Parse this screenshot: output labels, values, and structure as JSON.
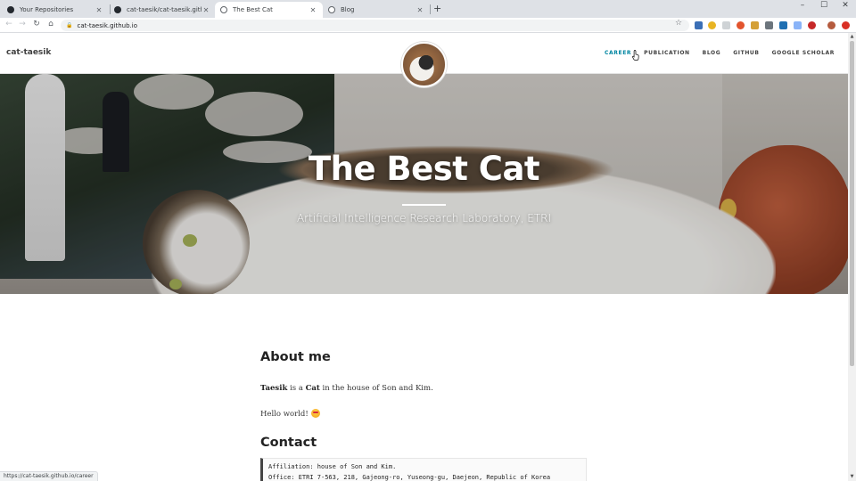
{
  "browser": {
    "tabs": [
      {
        "title": "Your Repositories",
        "favicon_color": "#24292f"
      },
      {
        "title": "cat-taesik/cat-taesik.github.io: B",
        "favicon_color": "#24292f"
      },
      {
        "title": "The Best Cat",
        "favicon_color": "#5f6368"
      },
      {
        "title": "Blog",
        "favicon_color": "#5f6368"
      }
    ],
    "url": "cat-taesik.github.io",
    "status_url": "https://cat-taesik.github.io/career"
  },
  "site": {
    "brand": "cat-taesik",
    "nav": [
      "CAREER",
      "PUBLICATION",
      "BLOG",
      "GITHUB",
      "GOOGLE SCHOLAR"
    ],
    "accent_color": "#0085a1"
  },
  "hero": {
    "title": "The Best Cat",
    "subtitle": "Artificial Intelligence Research Laboratory, ETRI"
  },
  "content": {
    "about_heading": "About me",
    "about_name": "Taesik",
    "about_mid": " is a ",
    "about_cat": "Cat",
    "about_rest": " in the house of Son and Kim.",
    "hello": "Hello world!",
    "contact_heading": "Contact",
    "contact_lines": [
      "Affiliation: house of Son and Kim.",
      "Office: ETRI 7-563, 218, Gajeong-ro, Yuseong-gu, Daejeon, Republic of Korea"
    ]
  }
}
